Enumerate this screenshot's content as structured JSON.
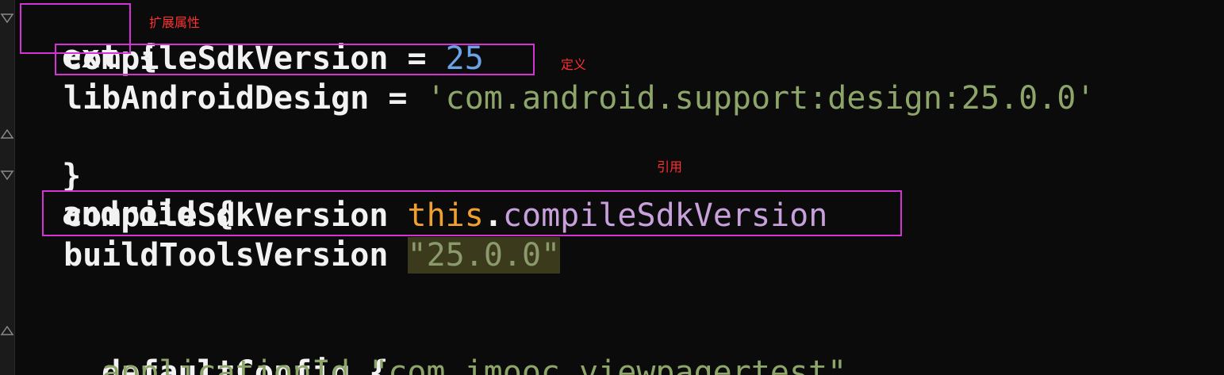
{
  "code_lines": {
    "l1": {
      "text": "ext {"
    },
    "l2": {
      "name": "compileSdkVersion",
      "op": " = ",
      "value": "25"
    },
    "l3": {
      "name": "libAndroidDesign",
      "op": " = ",
      "value": "'com.android.support:design:25.0.0'"
    },
    "l4": {
      "text": "}"
    },
    "l5": {
      "text": "android {"
    },
    "l6": {
      "name": "compileSdkVersion",
      "this_kw": "this",
      "dot": ".",
      "prop": "compileSdkVersion"
    },
    "l7": {
      "name": "buildToolsVersion",
      "value": "\"25.0.0\""
    },
    "l9": {
      "text": "defaultConfig {"
    },
    "l10": {
      "name": "applicationId",
      "value": "\"com.imooc.viewpagertest\""
    }
  },
  "annotations": {
    "ext_label": "扩展属性",
    "define_label": "定义",
    "reference_label": "引用"
  },
  "colors": {
    "background": "#0b0b0b",
    "annotation_box": "#d433d4",
    "annotation_text": "#ff3030",
    "string": "#8ea56a",
    "number": "#6aa2e8",
    "keyword_this": "#f0a030",
    "property": "#c7a0dc"
  }
}
